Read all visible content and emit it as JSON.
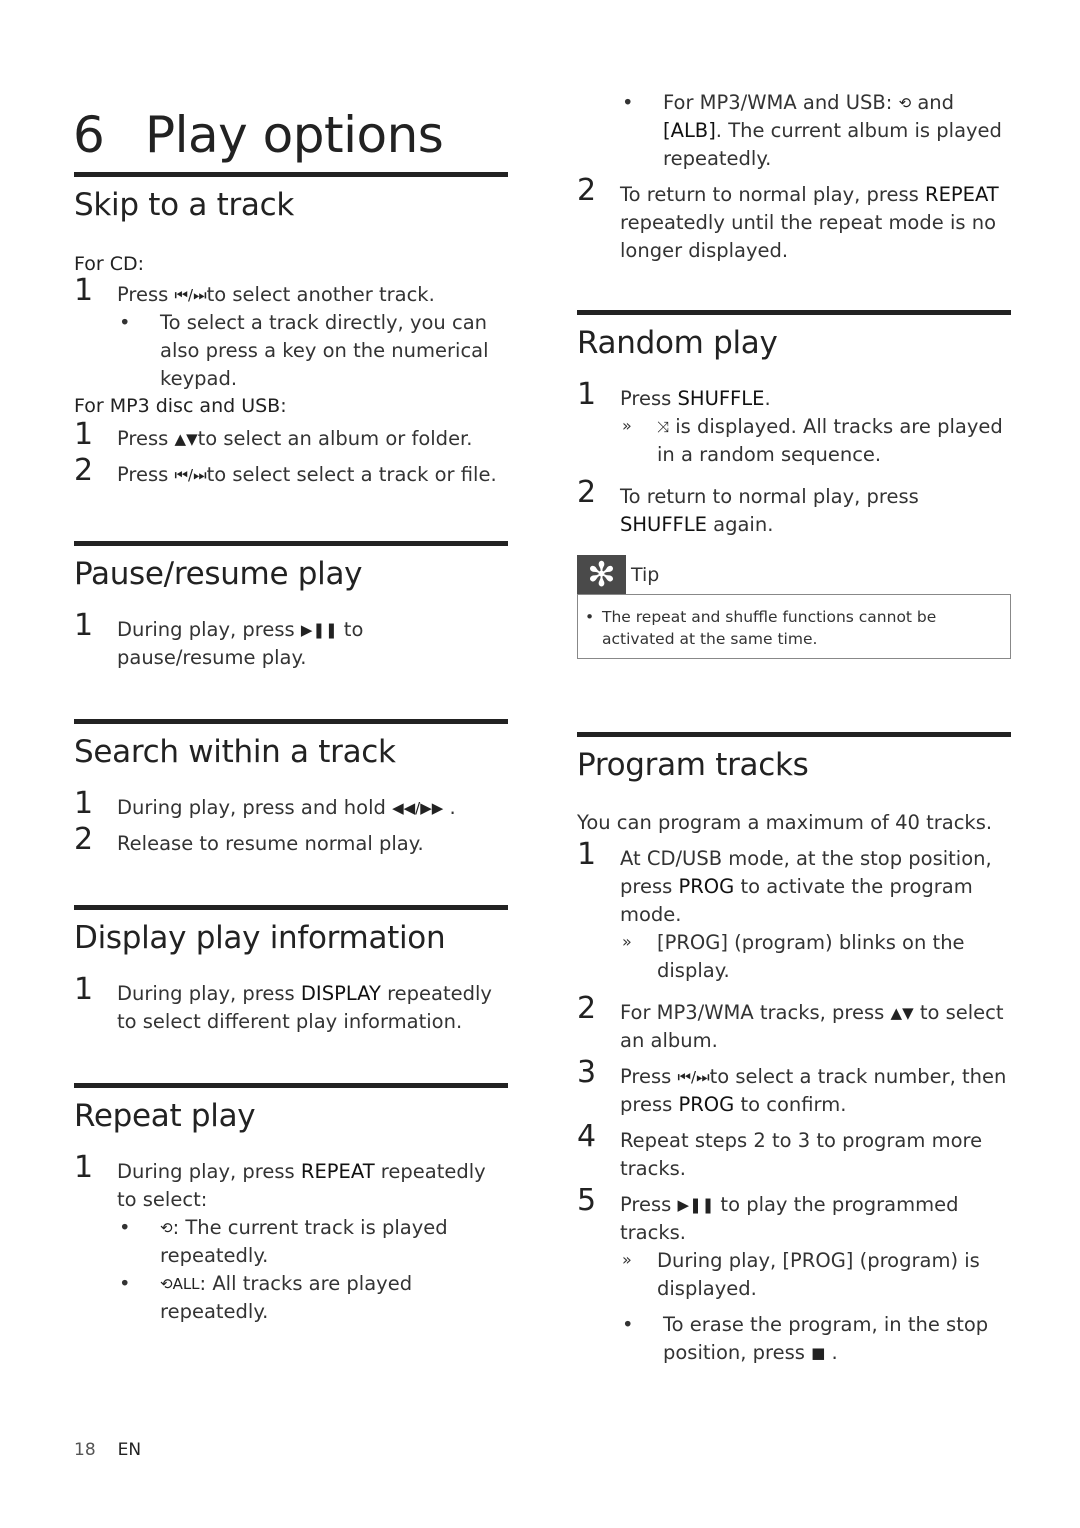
{
  "chapter": {
    "number": "6",
    "title": "Play options"
  },
  "left": {
    "skip": {
      "heading": "Skip to a track",
      "for_cd": "For CD:",
      "cd_step1": {
        "n": "1",
        "pre": "Press ",
        "icon": "⏮/⏭",
        "post": "to select another track."
      },
      "cd_bullet": "To select a track directly, you can also press a key on the numerical keypad.",
      "for_mp3": "For MP3 disc and USB:",
      "mp3_step1": {
        "n": "1",
        "pre": "Press ",
        "icon": "▲▼",
        "post": "to select an album or folder."
      },
      "mp3_step2": {
        "n": "2",
        "pre": "Press ",
        "icon": "⏮/⏭",
        "post": "to select select a track or file."
      }
    },
    "pause": {
      "heading": "Pause/resume play",
      "step1": {
        "n": "1",
        "pre": "During play, press ",
        "icon": "▶❚❚",
        "post": " to pause/resume play."
      }
    },
    "search": {
      "heading": "Search within a track",
      "step1": {
        "n": "1",
        "pre": "During play, press and hold ",
        "icon": "◀◀/▶▶",
        "post": " ."
      },
      "step2": {
        "n": "2",
        "text": "Release to resume normal play."
      }
    },
    "display": {
      "heading": "Display play information",
      "step1": {
        "n": "1",
        "pre": "During play, press ",
        "key": "DISPLAY",
        "post": " repeatedly to select different play information."
      }
    },
    "repeat": {
      "heading": "Repeat play",
      "step1": {
        "n": "1",
        "pre": "During play, press ",
        "key": "REPEAT",
        "post": " repeatedly to select:"
      },
      "bullet1": {
        "icon": "⟲",
        "text": ": The current track is played repeatedly."
      },
      "bullet2": {
        "icon": "⟲ALL",
        "text": ": All tracks are played repeatedly."
      }
    }
  },
  "right": {
    "repeat_cont": {
      "bullet3": {
        "pre": "For MP3/WMA and USB: ",
        "icon": "⟲",
        "mid": " and ",
        "key": "[ALB]",
        "post": ". The current album is played repeatedly."
      },
      "step2": {
        "n": "2",
        "pre": "To return to normal play, press ",
        "key": "REPEAT",
        "post": " repeatedly until the repeat mode is no longer displayed."
      }
    },
    "random": {
      "heading": "Random play",
      "step1": {
        "n": "1",
        "pre": "Press ",
        "key": "SHUFFLE",
        "post": "."
      },
      "result1": {
        "icon": "⤨",
        "text": " is displayed. All tracks are played in a random sequence."
      },
      "step2": {
        "n": "2",
        "pre": "To return to normal play, press ",
        "key": "SHUFFLE",
        "post": " again."
      }
    },
    "tip": {
      "label": "Tip",
      "icon": "✻",
      "text": "The repeat and shuffle functions cannot be activated at the same time."
    },
    "program": {
      "heading": "Program tracks",
      "intro": "You can program a maximum of 40 tracks.",
      "step1": {
        "n": "1",
        "pre": "At CD/USB mode, at the stop position, press ",
        "key": "PROG",
        "post": " to activate the program mode."
      },
      "result1": "[PROG] (program) blinks on the display.",
      "step2": {
        "n": "2",
        "pre": "For MP3/WMA tracks, press ",
        "icon": "▲▼",
        "post": " to select an album."
      },
      "step3": {
        "n": "3",
        "pre": "Press ",
        "icon": "⏮/⏭",
        "mid": "to select a track number, then press ",
        "key": "PROG",
        "post": " to confirm."
      },
      "step4": {
        "n": "4",
        "text": "Repeat steps 2 to 3 to program more tracks."
      },
      "step5": {
        "n": "5",
        "pre": "Press ",
        "icon": "▶❚❚",
        "post": " to play the programmed tracks."
      },
      "result5": "During play, [PROG] (program) is displayed.",
      "bullet": {
        "pre": "To erase the program, in the stop position, press ",
        "icon": "■",
        "post": " ."
      }
    }
  },
  "footer": {
    "page": "18",
    "lang": "EN"
  },
  "symbols": {
    "bullet": "•",
    "arrow": "»"
  }
}
